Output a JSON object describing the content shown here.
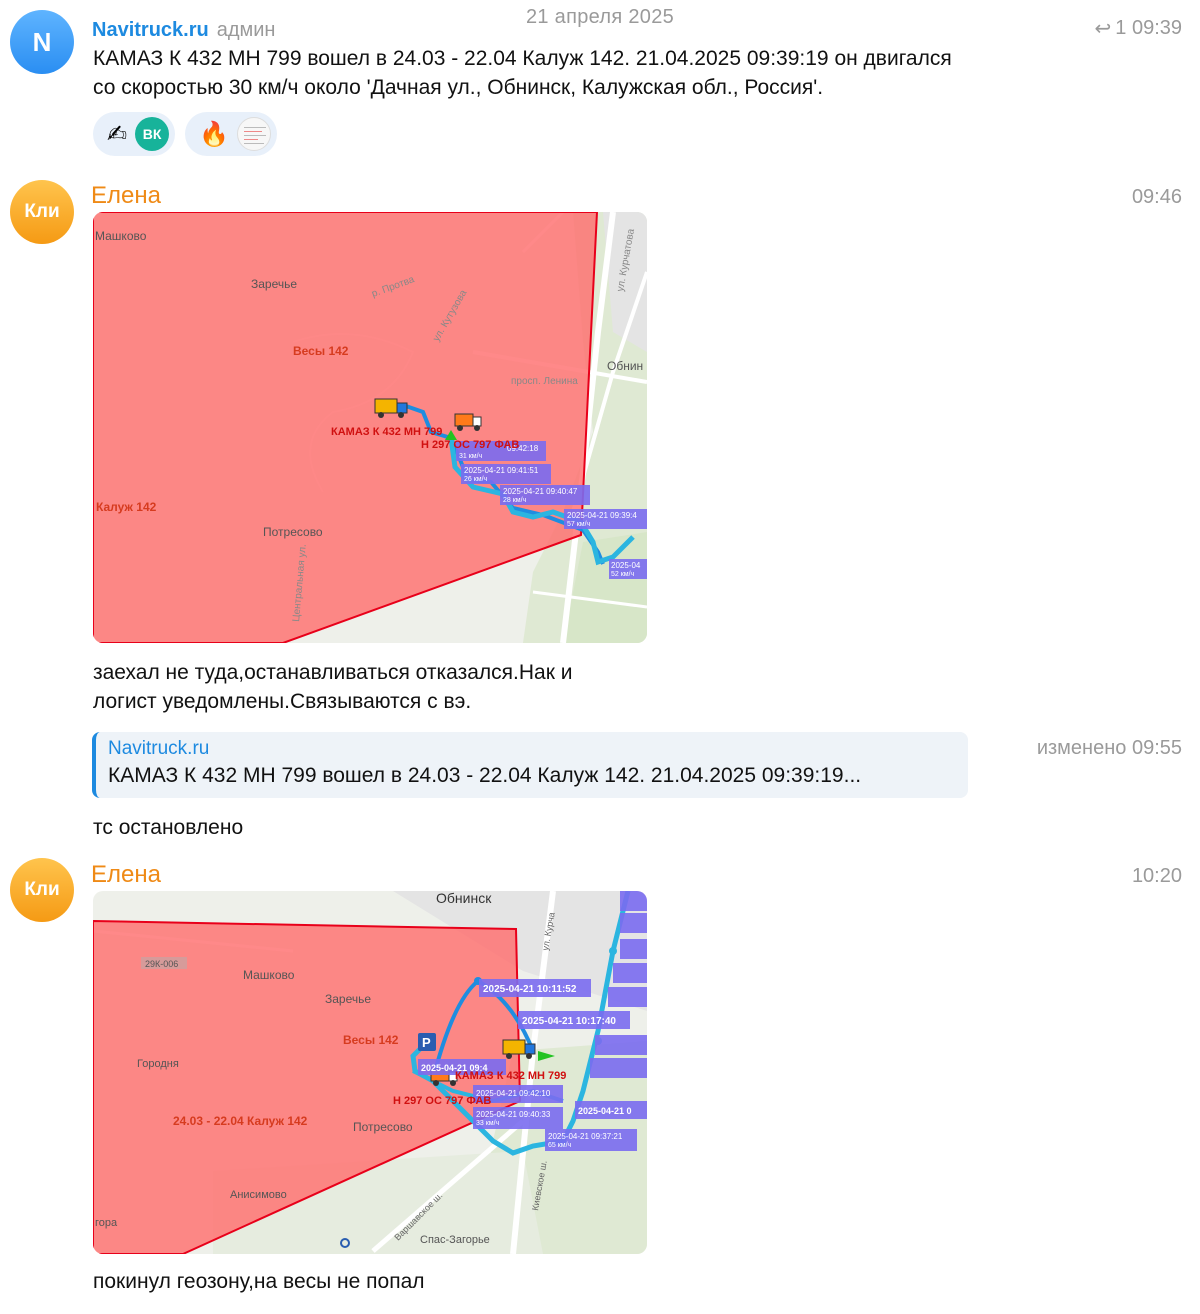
{
  "date_separator": "21 апреля 2025",
  "messages": [
    {
      "avatar_letter": "N",
      "sender": "Navitruck.ru",
      "role": "админ",
      "time": "1 09:39",
      "text_line1": "КАМАЗ К 432 МН 799 вошел в 24.03 - 22.04 Калуж 142. 21.04.2025 09:39:19 он двигался",
      "text_line2": "со скоростью 30 км/ч около 'Дачная ул., Обнинск, Калужская обл., Россия'.",
      "reactions": [
        {
          "emoji": "✍",
          "badge": "ВК"
        },
        {
          "emoji": "🔥",
          "badge": ""
        }
      ]
    },
    {
      "avatar_letter": "Кли",
      "sender": "Елена",
      "time": "09:46",
      "text_line1": "заехал не туда,останавливаться отказался.Нак и",
      "text_line2": "логист уведомлены.Связываются с вэ."
    },
    {
      "quote_name": "Navitruck.ru",
      "quote_text": "КАМАЗ К 432 МН 799 вошел в 24.03 - 22.04 Калуж 142. 21.04.2025 09:39:19...",
      "time": "изменено 09:55",
      "text": "тс остановлено"
    },
    {
      "avatar_letter": "Кли",
      "sender": "Елена",
      "time": "10:20",
      "text": "покинул геозону,на весы не попал"
    }
  ],
  "map1": {
    "places": [
      "Машково",
      "Заречье",
      "Потресово",
      "Обнин",
      "р. Протва",
      "просп. Ленина",
      "ул. Кутузова",
      "ул. Курчатова",
      "Центральная ул."
    ],
    "zones": [
      "Весы 142",
      "Калуж 142"
    ],
    "vehicles": [
      "КАМАЗ К 432 МН 799",
      "Н 297 ОС 797 ФАВ"
    ],
    "track_labels": [
      {
        "time": "09:42:18",
        "speed": "31 км/ч"
      },
      {
        "time": "2025-04-21 09:41:51",
        "speed": "26 км/ч"
      },
      {
        "time": "2025-04-21 09:40:47",
        "speed": "28 км/ч"
      },
      {
        "time": "2025-04-21 09:39:4",
        "speed": "57 км/ч"
      },
      {
        "time": "2025-04",
        "speed": "52 км/ч"
      }
    ]
  },
  "map2": {
    "places": [
      "Обнинск",
      "Машково",
      "Заречье",
      "Потресово",
      "Городня",
      "Анисимово",
      "Спас-Загорье",
      "Варшавское ш.",
      "Киевское ш.",
      "ул. Курча",
      "гора",
      "29К-006"
    ],
    "zones": [
      "Весы 142",
      "24.03 - 22.04 Калуж 142"
    ],
    "vehicles": [
      "КАМАЗ К 432 МН 799",
      "Н 297 ОС 797 ФАВ"
    ],
    "track_labels": [
      {
        "time": "2025-04-21 10:11:52",
        "speed": ""
      },
      {
        "time": "2025-04-21 10:17:40",
        "speed": ""
      },
      {
        "time": "2025-04-21 09:4",
        "speed": ""
      },
      {
        "time": "2025-04-21 09:42:10",
        "speed": ""
      },
      {
        "time": "2025-04-21 09:40:33",
        "speed": "33 км/ч"
      },
      {
        "time": "2025-04-21 0",
        "speed": ""
      },
      {
        "time": "2025-04-21 09:37:21",
        "speed": "65 км/ч"
      }
    ]
  },
  "colors": {
    "accent_blue": "#1d8ae0",
    "sender_orange": "#ef8a16",
    "zone_fill": "#ff6f6f",
    "track": "#2bb5e0",
    "label_bg": "#7a6cf0"
  }
}
